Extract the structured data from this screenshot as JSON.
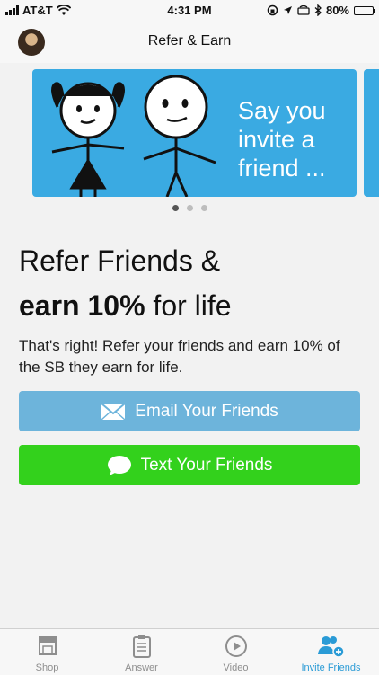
{
  "status_bar": {
    "carrier": "AT&T",
    "time": "4:31 PM",
    "battery_percent": "80%",
    "battery_level": 0.8
  },
  "header": {
    "title": "Refer & Earn"
  },
  "carousel": {
    "slide_text": "Say you\ninvite a\nfriend ...",
    "page_count": 3,
    "active_page": 1,
    "slide_color": "#3aaae2"
  },
  "main": {
    "headline_line1": "Refer Friends &",
    "headline_bold": "earn 10%",
    "headline_rest": " for life",
    "description": "That's right! Refer your friends and earn 10% of the SB they earn for life."
  },
  "buttons": {
    "email_label": "Email Your Friends",
    "text_label": "Text Your Friends",
    "email_color": "#6db4db",
    "text_color": "#33d11c"
  },
  "tabs": [
    {
      "label": "Shop",
      "icon": "shop-icon",
      "active": false
    },
    {
      "label": "Answer",
      "icon": "clipboard-icon",
      "active": false
    },
    {
      "label": "Video",
      "icon": "play-icon",
      "active": false
    },
    {
      "label": "Invite Friends",
      "icon": "add-friends-icon",
      "active": true
    }
  ],
  "accent_color": "#2a9bd6"
}
